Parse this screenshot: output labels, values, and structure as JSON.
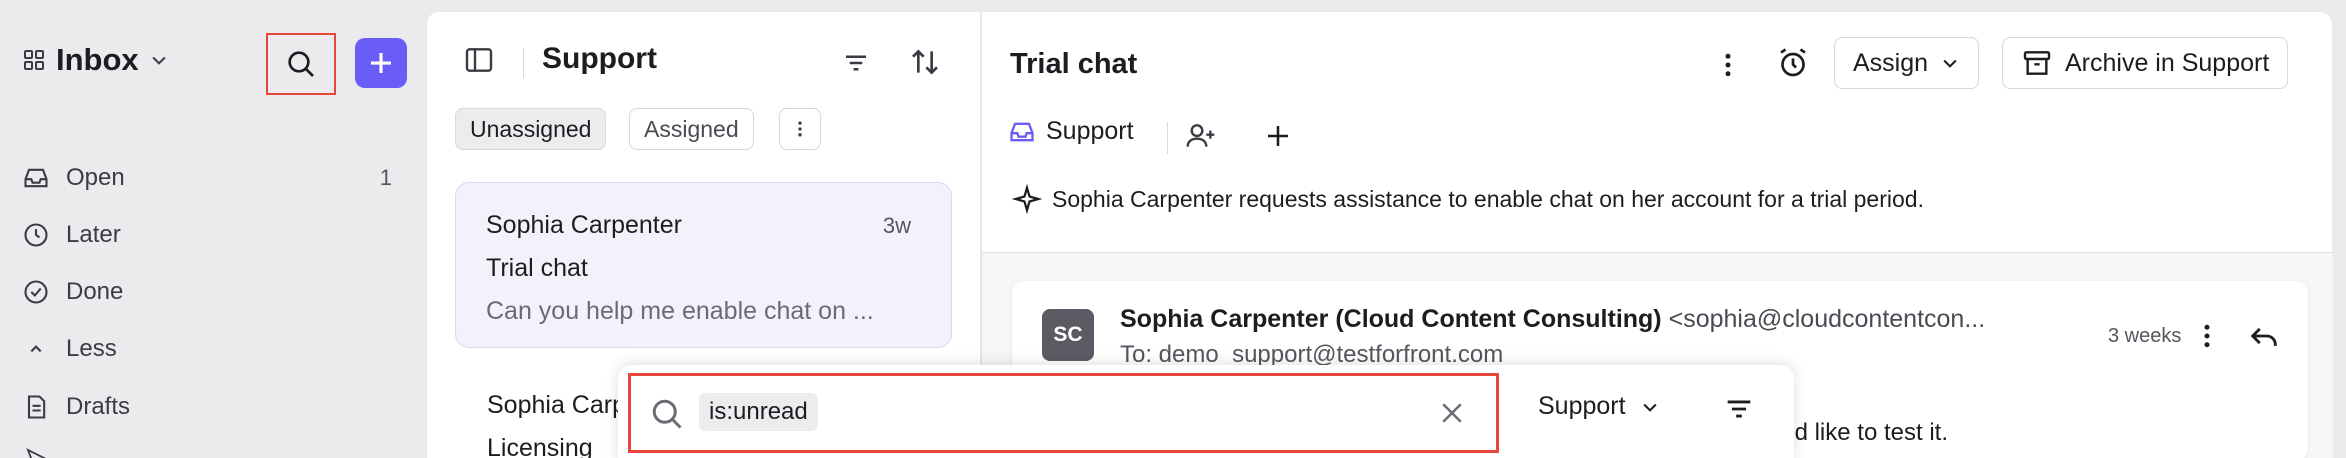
{
  "sidebar": {
    "inbox_title": "Inbox",
    "nav": [
      {
        "label": "Open",
        "count": "1"
      },
      {
        "label": "Later",
        "count": ""
      },
      {
        "label": "Done",
        "count": ""
      },
      {
        "label": "Less",
        "count": ""
      },
      {
        "label": "Drafts",
        "count": ""
      }
    ]
  },
  "list": {
    "title": "Support",
    "tabs": [
      "Unassigned",
      "Assigned"
    ],
    "conversations": [
      {
        "name": "Sophia Carpenter",
        "time": "3w",
        "subject": "Trial chat",
        "preview": "Can you help me enable chat on ..."
      },
      {
        "name": "Sophia Carp",
        "subject": "Licensing"
      }
    ]
  },
  "conversation": {
    "title": "Trial chat",
    "assign_label": "Assign",
    "archive_label": "Archive in Support",
    "inbox_tag": "Support",
    "summary": "Sophia Carpenter requests assistance to enable chat on her account for a trial period.",
    "message": {
      "avatar_initials": "SC",
      "sender_name": "Sophia Carpenter (Cloud Content Consulting)",
      "sender_email": "<sophia@cloudcontentcon...",
      "to": "To: demo_support@testforfront.com",
      "time": "3 weeks",
      "body_fragment": "'d like to test it."
    }
  },
  "search": {
    "query_chip": "is:unread",
    "inbox_filter": "Support"
  },
  "colors": {
    "accent_purple": "#6a5cf6",
    "highlight_red": "#e5483a",
    "selected_card": "#f2f2fa"
  }
}
